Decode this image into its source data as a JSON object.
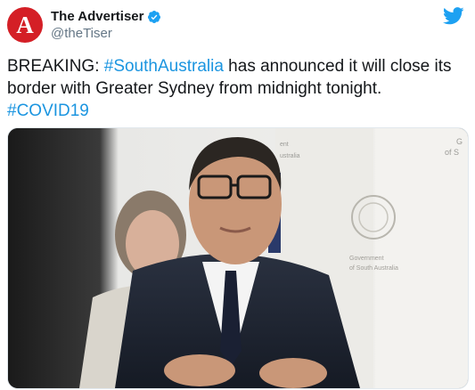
{
  "author": {
    "display_name": "The Advertiser",
    "handle": "@theTiser",
    "avatar_letter": "A",
    "avatar_color": "#d41f26",
    "verified": true,
    "verified_icon": "verified-badge-icon"
  },
  "tweet": {
    "text_parts": [
      {
        "type": "text",
        "value": "BREAKING: "
      },
      {
        "type": "hashtag",
        "value": "#SouthAustralia"
      },
      {
        "type": "text",
        "value": " has announced it will close its border with Greater Sydney from midnight tonight. "
      },
      {
        "type": "hashtag",
        "value": "#COVID19"
      }
    ]
  },
  "media": {
    "description_icon": "photo",
    "backdrop_lines": [
      "Government",
      "of South Australia"
    ],
    "backdrop_fragments": [
      "G",
      "of S",
      "ent",
      "ustralia"
    ]
  },
  "colors": {
    "hashtag": "#1b95e0",
    "twitter_blue": "#1da1f2",
    "text": "#14171a",
    "secondary": "#657786"
  }
}
